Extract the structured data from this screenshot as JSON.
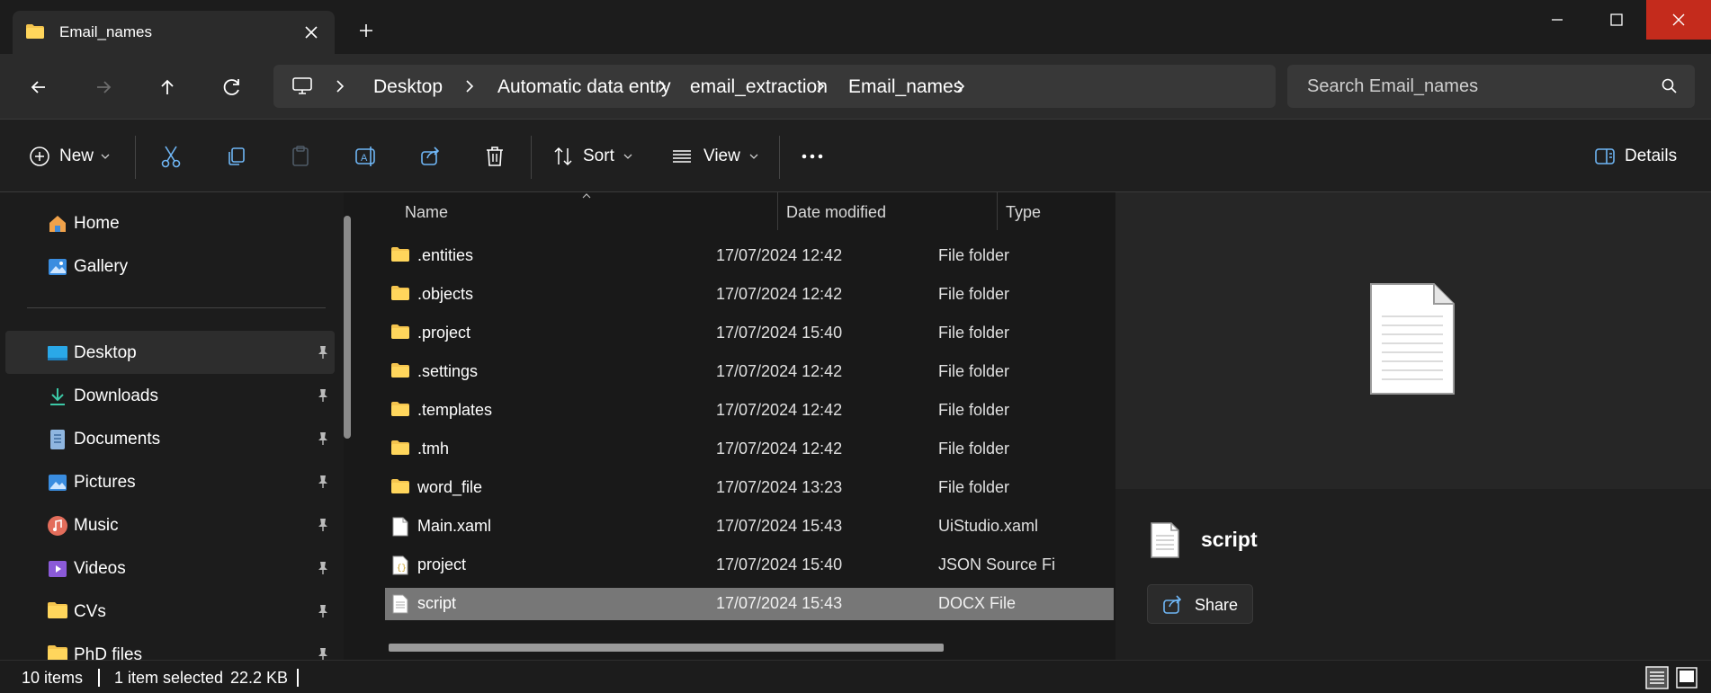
{
  "window": {
    "tab_title": "Email_names",
    "accent": "#c42b1c"
  },
  "breadcrumb": [
    "Desktop",
    "Automatic data entry",
    "email_extraction",
    "Email_names"
  ],
  "search": {
    "placeholder": "Search Email_names"
  },
  "toolbar": {
    "new_label": "New",
    "sort_label": "Sort",
    "view_label": "View",
    "details_label": "Details"
  },
  "sidebar": {
    "items": [
      {
        "label": "Home",
        "icon": "home-icon"
      },
      {
        "label": "Gallery",
        "icon": "gallery-icon"
      },
      {
        "label": "Desktop",
        "icon": "desktop-icon"
      },
      {
        "label": "Downloads",
        "icon": "downloads-icon"
      },
      {
        "label": "Documents",
        "icon": "documents-icon"
      },
      {
        "label": "Pictures",
        "icon": "pictures-icon"
      },
      {
        "label": "Music",
        "icon": "music-icon"
      },
      {
        "label": "Videos",
        "icon": "videos-icon"
      },
      {
        "label": "CVs",
        "icon": "folder-icon"
      },
      {
        "label": "PhD files",
        "icon": "folder-icon"
      }
    ]
  },
  "columns": {
    "name": "Name",
    "date": "Date modified",
    "type": "Type"
  },
  "files": [
    {
      "name": ".entities",
      "date": "17/07/2024 12:42",
      "type": "File folder",
      "icon": "folder-icon"
    },
    {
      "name": ".objects",
      "date": "17/07/2024 12:42",
      "type": "File folder",
      "icon": "folder-icon"
    },
    {
      "name": ".project",
      "date": "17/07/2024 15:40",
      "type": "File folder",
      "icon": "folder-icon"
    },
    {
      "name": ".settings",
      "date": "17/07/2024 12:42",
      "type": "File folder",
      "icon": "folder-icon"
    },
    {
      "name": ".templates",
      "date": "17/07/2024 12:42",
      "type": "File folder",
      "icon": "folder-icon"
    },
    {
      "name": ".tmh",
      "date": "17/07/2024 12:42",
      "type": "File folder",
      "icon": "folder-icon"
    },
    {
      "name": "word_file",
      "date": "17/07/2024 13:23",
      "type": "File folder",
      "icon": "folder-icon"
    },
    {
      "name": "Main.xaml",
      "date": "17/07/2024 15:43",
      "type": "UiStudio.xaml",
      "icon": "file-icon"
    },
    {
      "name": "project",
      "date": "17/07/2024 15:40",
      "type": "JSON Source Fi",
      "icon": "json-file-icon"
    },
    {
      "name": "script",
      "date": "17/07/2024 15:43",
      "type": "DOCX File",
      "icon": "docx-file-icon"
    }
  ],
  "details": {
    "name": "script",
    "share_label": "Share"
  },
  "status": {
    "count": "10 items",
    "selected": "1 item selected",
    "size": "22.2 KB"
  }
}
